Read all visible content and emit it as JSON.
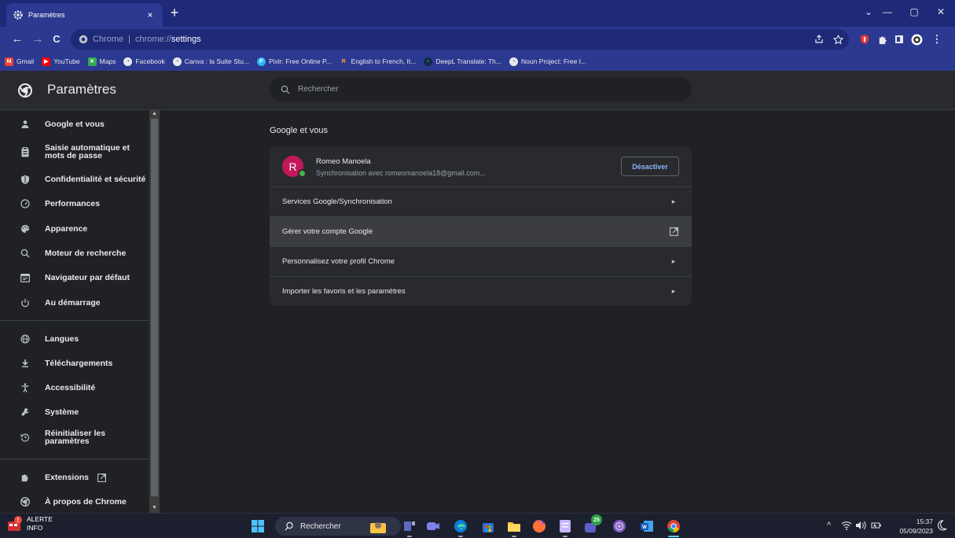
{
  "window": {
    "tab_title": "Paramètres",
    "tab_close": "×",
    "new_tab": "+",
    "controls": {
      "minimize": "—",
      "restore": "▢",
      "close": "✕",
      "chevron": "⌄"
    }
  },
  "toolbar": {
    "back": "←",
    "forward": "→",
    "reload": "C",
    "url_host": "Chrome",
    "url_sep": "|",
    "url_scheme": "chrome://",
    "url_path": "settings"
  },
  "bookmarks": [
    {
      "label": "Gmail",
      "color": "#ea4335",
      "icon": "gmail-icon"
    },
    {
      "label": "YouTube",
      "color": "#ff0000",
      "icon": "youtube-icon"
    },
    {
      "label": "Maps",
      "color": "#34a853",
      "icon": "maps-icon"
    },
    {
      "label": "Facebook",
      "color": "#e8eaed",
      "icon": "globe-icon"
    },
    {
      "label": "Canva : la Suite Stu...",
      "color": "#e8eaed",
      "icon": "globe-icon"
    },
    {
      "label": "Pixlr: Free Online P...",
      "color": "#29b6f6",
      "icon": "pixlr-icon"
    },
    {
      "label": "English to French, It...",
      "color": "#f9a825",
      "icon": "reverso-icon"
    },
    {
      "label": "DeepL Translate: Th...",
      "color": "#0f2b46",
      "icon": "deepl-icon"
    },
    {
      "label": "Noun Project: Free I...",
      "color": "#e8eaed",
      "icon": "globe-icon"
    }
  ],
  "settings": {
    "title": "Paramètres",
    "search_placeholder": "Rechercher"
  },
  "sidebar": {
    "items": [
      {
        "label": "Google et vous",
        "icon": "person-icon"
      },
      {
        "label": "Saisie automatique et\nmots de passe",
        "icon": "clipboard-icon"
      },
      {
        "label": "Confidentialité et sécurité",
        "icon": "shield-icon"
      },
      {
        "label": "Performances",
        "icon": "gauge-icon"
      },
      {
        "label": "Apparence",
        "icon": "palette-icon"
      },
      {
        "label": "Moteur de recherche",
        "icon": "search-icon"
      },
      {
        "label": "Navigateur par défaut",
        "icon": "browser-icon"
      },
      {
        "label": "Au démarrage",
        "icon": "power-icon"
      },
      {
        "label": "Langues",
        "icon": "globe-icon"
      },
      {
        "label": "Téléchargements",
        "icon": "download-icon"
      },
      {
        "label": "Accessibilité",
        "icon": "accessibility-icon"
      },
      {
        "label": "Système",
        "icon": "wrench-icon"
      },
      {
        "label": "Réinitialiser les\nparamètres",
        "icon": "history-icon"
      },
      {
        "label": "Extensions",
        "icon": "puzzle-icon"
      },
      {
        "label": "À propos de Chrome",
        "icon": "chrome-icon"
      }
    ]
  },
  "main": {
    "section_title": "Google et vous",
    "profile": {
      "initial": "R",
      "name": "Romeo Manoela",
      "sync_text": "Synchronisation avec romeomanoela18@gmail.com...",
      "disable_button": "Désactiver"
    },
    "rows": [
      {
        "label": "Services Google/Synchronisation",
        "end": "▸"
      },
      {
        "label": "Gérer votre compte Google",
        "end": "external"
      },
      {
        "label": "Personnalisez votre profil Chrome",
        "end": "▸"
      },
      {
        "label": "Importer les favoris et les paramètres",
        "end": "▸"
      }
    ]
  },
  "taskbar": {
    "alert_title": "ALERTE",
    "alert_sub": "INFO",
    "search_label": "Rechercher",
    "badge_count": "25",
    "time": "15:37",
    "date": "05/09/2023"
  },
  "colors": {
    "accent": "#8ab4f8",
    "titlebar": "#1e2a78",
    "toolbar": "#2b3990",
    "avatar": "#c2185b"
  }
}
